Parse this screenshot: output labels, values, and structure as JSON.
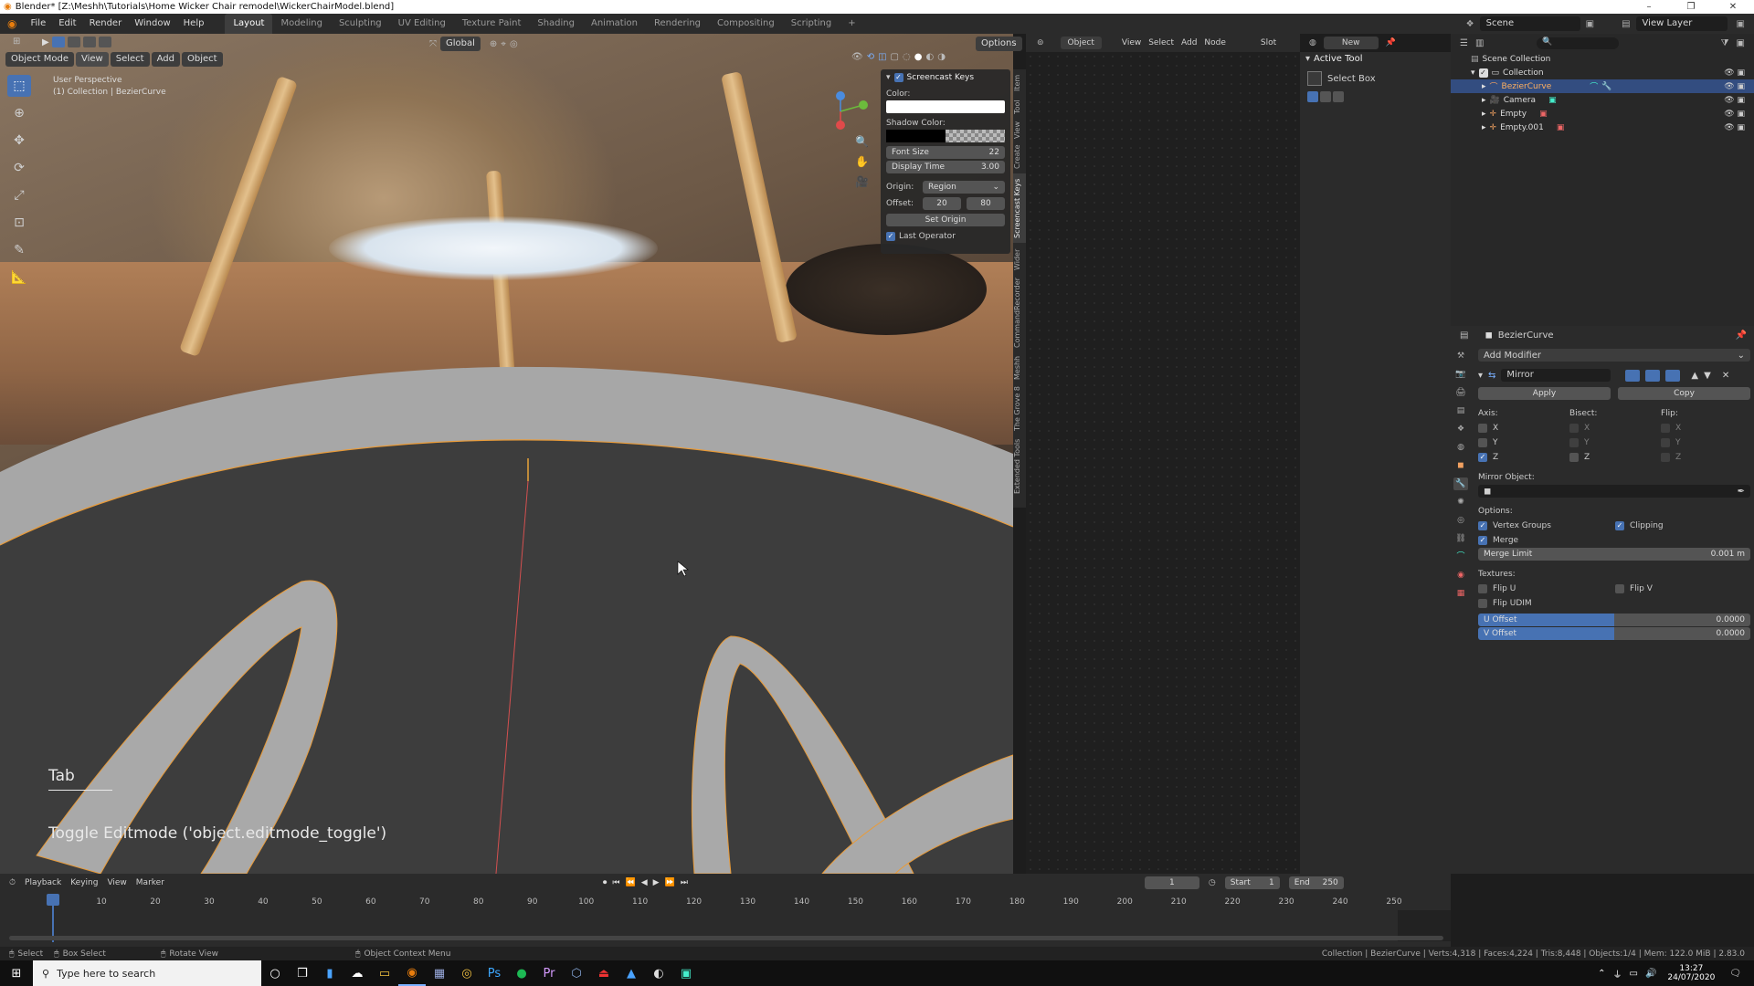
{
  "window": {
    "title": "Blender* [Z:\\Meshh\\Tutorials\\Home Wicker Chair remodel\\WickerChairModel.blend]",
    "controls": [
      "–",
      "❐",
      "✕"
    ]
  },
  "menu": [
    "File",
    "Edit",
    "Render",
    "Window",
    "Help"
  ],
  "workspaces": [
    "Layout",
    "Modeling",
    "Sculpting",
    "UV Editing",
    "Texture Paint",
    "Shading",
    "Animation",
    "Rendering",
    "Compositing",
    "Scripting",
    "+"
  ],
  "active_workspace": "Layout",
  "topbar_right": {
    "scene": "Scene",
    "view_layer": "View Layer"
  },
  "viewport": {
    "mode": "Object Mode",
    "menus": [
      "View",
      "Select",
      "Add",
      "Object"
    ],
    "transform": "Global",
    "options": "Options",
    "perspective": "User Perspective",
    "collection_label": "(1) Collection | BezierCurve",
    "key_display": "Tab",
    "operator_display": "Toggle Editmode ('object.editmode_toggle')"
  },
  "screencast_panel": {
    "header": "Screencast Keys",
    "color_label": "Color:",
    "shadow_label": "Shadow Color:",
    "font_size_label": "Font Size",
    "font_size_value": "22",
    "display_time_label": "Display Time",
    "display_time_value": "3.00",
    "origin_label": "Origin:",
    "origin_value": "Region",
    "offset_label": "Offset:",
    "offset_x": "20",
    "offset_y": "80",
    "set_origin": "Set Origin",
    "last_operator": "Last Operator"
  },
  "side_tabs": [
    "Item",
    "Tool",
    "View",
    "Create",
    "Screencast Keys",
    "Wider",
    "CommandRecorder",
    "Meshh",
    "The Grove 8",
    "Extended Tools"
  ],
  "node_editor": {
    "object_menu": "Object",
    "menus": [
      "View",
      "Select",
      "Add",
      "Node"
    ],
    "slot": "Slot",
    "new_button": "New"
  },
  "active_tool": {
    "header": "Active Tool",
    "tool_name": "Select Box"
  },
  "outliner": {
    "root": "Scene Collection",
    "items": [
      {
        "name": "Collection",
        "selected": false
      },
      {
        "name": "BezierCurve",
        "selected": true
      },
      {
        "name": "Camera",
        "selected": false
      },
      {
        "name": "Empty",
        "selected": false
      },
      {
        "name": "Empty.001",
        "selected": false
      }
    ]
  },
  "properties": {
    "object_name": "BezierCurve",
    "add_modifier": "Add Modifier",
    "modifier_name": "Mirror",
    "apply": "Apply",
    "copy": "Copy",
    "axis_label": "Axis:",
    "bisect_label": "Bisect:",
    "flip_label": "Flip:",
    "axes": [
      "X",
      "Y",
      "Z"
    ],
    "mirror_object_label": "Mirror Object:",
    "options_label": "Options:",
    "vertex_groups": "Vertex Groups",
    "clipping": "Clipping",
    "merge": "Merge",
    "merge_limit_label": "Merge Limit",
    "merge_limit_value": "0.001 m",
    "textures_label": "Textures:",
    "flip_u": "Flip U",
    "flip_v": "Flip V",
    "flip_udim": "Flip UDIM",
    "u_offset_label": "U Offset",
    "u_offset_value": "0.0000",
    "v_offset_label": "V Offset",
    "v_offset_value": "0.0000"
  },
  "timeline": {
    "menus": [
      "Playback",
      "Keying",
      "View",
      "Marker"
    ],
    "current_frame": "1",
    "start_label": "Start",
    "start_value": "1",
    "end_label": "End",
    "end_value": "250",
    "ticks": [
      "1",
      "10",
      "20",
      "30",
      "40",
      "50",
      "60",
      "70",
      "80",
      "90",
      "100",
      "110",
      "120",
      "130",
      "140",
      "150",
      "160",
      "170",
      "180",
      "190",
      "200",
      "210",
      "220",
      "230",
      "240",
      "250"
    ]
  },
  "statusbar": {
    "select": "Select",
    "box_select": "Box Select",
    "rotate_view": "Rotate View",
    "context_menu": "Object Context Menu",
    "stats": "Collection | BezierCurve | Verts:4,318 | Faces:4,224 | Tris:8,448 | Objects:1/4 | Mem: 122.0 MiB | 2.83.0"
  },
  "taskbar": {
    "search_placeholder": "Type here to search",
    "time": "13:27",
    "date": "24/07/2020"
  }
}
